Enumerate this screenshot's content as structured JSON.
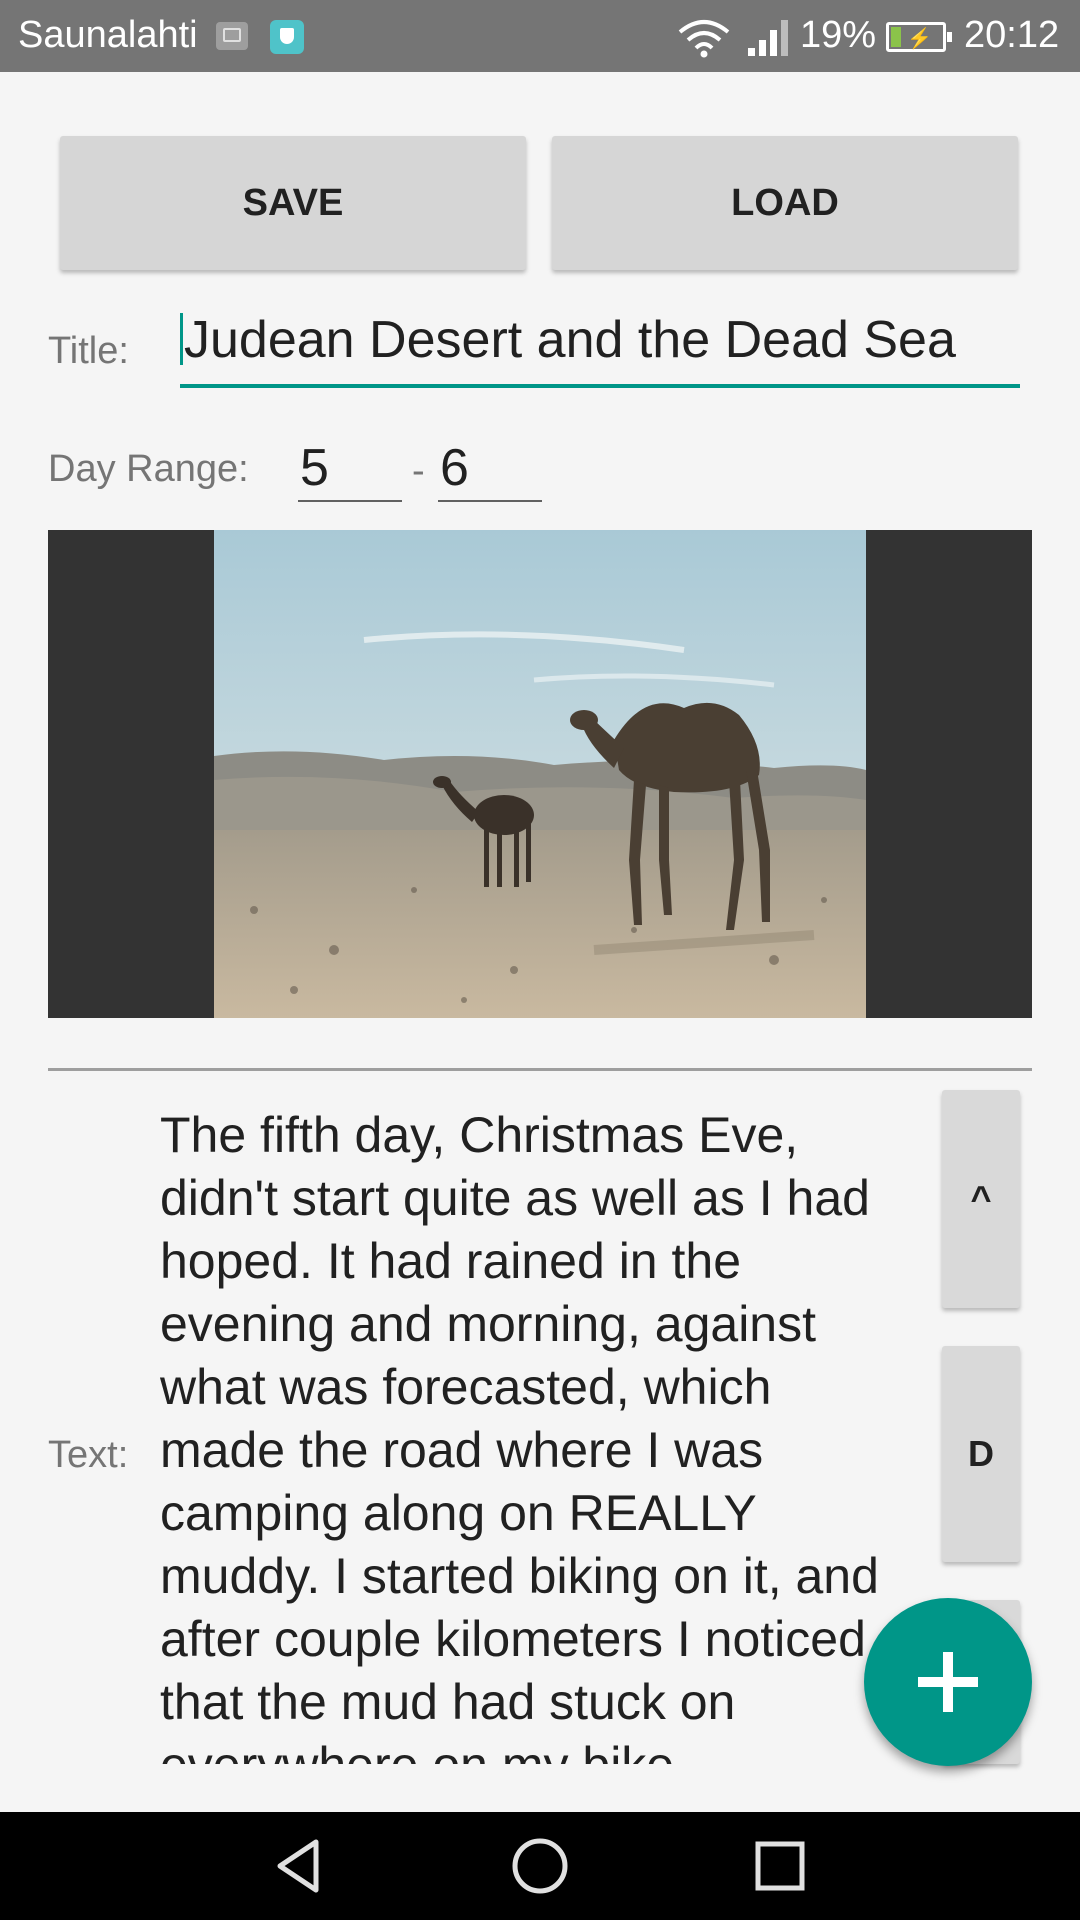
{
  "status_bar": {
    "carrier": "Saunalahti",
    "battery_percent": "19%",
    "battery_level": 0.19,
    "time": "20:12",
    "icons": [
      "image-notification-icon",
      "shield-icon",
      "wifi-icon",
      "signal-icon",
      "battery-charging-icon"
    ]
  },
  "toolbar": {
    "save_label": "SAVE",
    "load_label": "LOAD"
  },
  "form": {
    "title_label": "Title:",
    "title_value": "Judean Desert and the Dead Sea",
    "day_range_label": "Day Range:",
    "day_start": "5",
    "day_separator": "-",
    "day_end": "6",
    "text_label": "Text:",
    "text_value": "The fifth day, Christmas Eve, didn't start quite as well as I had hoped. It had rained in the evening and morning, against what was forecasted, which made the road where I was camping along on REALLY muddy. I started biking on it, and after couple kilometers I noticed that the mud had stuck on everywhere on my bike"
  },
  "side_buttons": {
    "up_label": "^",
    "d_label": "D"
  },
  "fab": {
    "icon": "plus-icon"
  },
  "navigation": {
    "icons": [
      "back-icon",
      "home-icon",
      "recents-icon"
    ]
  },
  "colors": {
    "accent": "#009688",
    "status_bar": "#757575",
    "button": "#d6d6d6"
  }
}
